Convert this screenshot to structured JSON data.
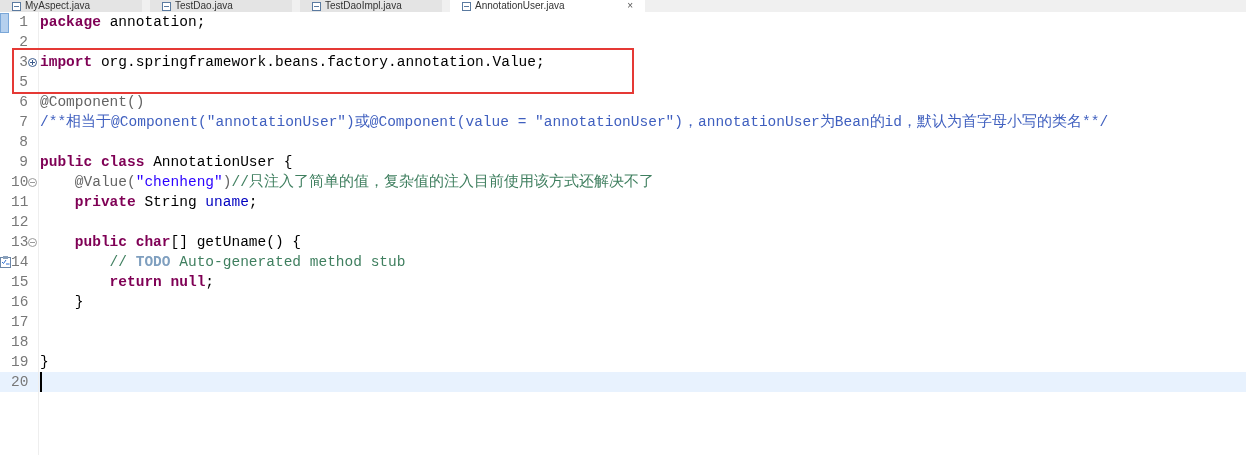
{
  "tabs": [
    {
      "label": "MyAspect.java",
      "selected": false
    },
    {
      "label": "TestDao.java",
      "selected": false
    },
    {
      "label": "TestDaoImpl.java",
      "selected": false
    },
    {
      "label": "AnnotationUser.java",
      "selected": true,
      "close": "×"
    }
  ],
  "lines": [
    {
      "number": "1",
      "segments": [
        {
          "kind": "keyword",
          "text": "package"
        },
        {
          "kind": "plain",
          "text": "annotation;"
        }
      ]
    },
    {
      "number": "2"
    },
    {
      "number": "3",
      "collapsed": true,
      "highlighted": true,
      "segments": [
        {
          "kind": "keyword",
          "text": "import"
        },
        {
          "kind": "plain",
          "text": "org.springframework.beans.factory.annotation.Value;"
        }
      ]
    },
    {
      "number": "5",
      "highlighted": true
    },
    {
      "number": "6",
      "segments": [
        {
          "kind": "annotation",
          "text": "@Component()"
        }
      ]
    },
    {
      "number": "7",
      "segments": [
        {
          "kind": "javadoc",
          "text": "/**相当于@Component(\"annotationUser\")或@Component(value = \"annotationUser\")，annotationUser为Bean的id，默认为首字母小写的类名**/"
        }
      ]
    },
    {
      "number": "8"
    },
    {
      "number": "9",
      "segments": [
        {
          "kind": "keyword",
          "text": "public"
        },
        {
          "kind": "keyword",
          "text": "class"
        },
        {
          "kind": "plain",
          "text": "AnnotationUser {"
        }
      ],
      "children": [
        {
          "number": "10",
          "collapsed": false,
          "segments": [
            {
              "kind": "annotation",
              "text": "@Value("
            },
            {
              "kind": "string",
              "text": "\"chenheng\"",
              "attached": true
            },
            {
              "kind": "annotation",
              "text": ")",
              "attached": true
            },
            {
              "kind": "comment",
              "text": "//只注入了简单的值，复杂值的注入目前使用该方式还解决不了",
              "attached": true
            }
          ]
        },
        {
          "number": "11",
          "segments": [
            {
              "kind": "keyword",
              "text": "private"
            },
            {
              "kind": "plain",
              "text": "String"
            },
            {
              "kind": "field",
              "text": "uname"
            },
            {
              "kind": "plain",
              "text": ";",
              "attached": true
            }
          ]
        },
        {
          "number": "12"
        },
        {
          "number": "13",
          "collapsed": false,
          "segments": [
            {
              "kind": "keyword",
              "text": "public"
            },
            {
              "kind": "keyword",
              "text": "char"
            },
            {
              "kind": "plain",
              "text": "[] getUname() {",
              "attached": true
            }
          ],
          "children": [
            {
              "number": "14",
              "task": true,
              "segments": [
                {
                  "kind": "comment",
                  "text": "//"
                },
                {
                  "kind": "todo",
                  "text": "TODO"
                },
                {
                  "kind": "comment",
                  "text": "Auto-generated method stub"
                }
              ]
            },
            {
              "number": "15",
              "segments": [
                {
                  "kind": "keyword",
                  "text": "return"
                },
                {
                  "kind": "keyword",
                  "text": "null"
                },
                {
                  "kind": "plain",
                  "text": ";",
                  "attached": true
                }
              ]
            }
          ]
        },
        {
          "number": "16",
          "segments": [
            {
              "kind": "plain",
              "text": "}"
            }
          ]
        }
      ]
    },
    {
      "number": "17"
    },
    {
      "number": "18"
    },
    {
      "number": "19",
      "segments": [
        {
          "kind": "plain",
          "text": "}"
        }
      ]
    },
    {
      "number": "20",
      "current": true
    }
  ]
}
